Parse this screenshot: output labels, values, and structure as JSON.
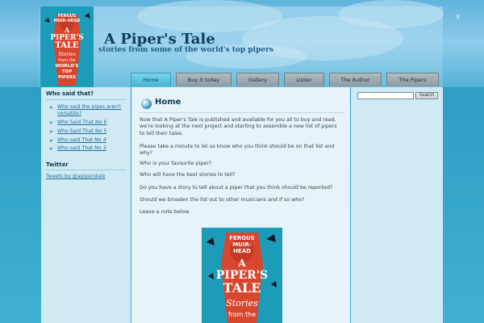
{
  "header": {
    "title": "A Piper's Tale",
    "subtitle": "stories from some of the world's top pipers",
    "close_label": "x"
  },
  "cover": {
    "author_line1": "FERGUS",
    "author_line2": "MUIR-",
    "author_line3": "HEAD",
    "title_line1": "A",
    "title_line2": "PIPER'S",
    "title_line3": "TALE",
    "tagline_line1": "Stories",
    "tagline_line2": "from the"
  },
  "cover_small": {
    "author_line1": "FERGUS",
    "author_line2": "MUIR-HEAD",
    "title_line1": "A",
    "title_line2": "PIPER'S",
    "title_line3": "TALE",
    "tagline_line1": "Stories",
    "tagline_line2": "from the",
    "tagline_line3": "WORLD'S",
    "tagline_line4": "TOP",
    "tagline_line5": "PIPERS"
  },
  "nav": {
    "tabs": [
      {
        "label": "Home",
        "active": true
      },
      {
        "label": "Buy it today"
      },
      {
        "label": "Gallery"
      },
      {
        "label": "Listen"
      },
      {
        "label": "The Author"
      },
      {
        "label": "The Pipers"
      }
    ]
  },
  "sidebar": {
    "heading": "Who said that?",
    "links": [
      "Who said the pipes aren't versatile?",
      "Who Said That No 6",
      "Who Said That No 5",
      "Who said That No 4",
      "Who said That No 3"
    ],
    "twitter_heading": "Twitter",
    "twitter_link": "Tweets by @apiperstale"
  },
  "main": {
    "title": "Home",
    "paragraphs": [
      "Now that A Piper's Tale is published and available for you all to buy and read, we're looking at the next project and starting to assemble a new list of pipers to tell their tales.",
      "Please take a minute to let us know who you think should be on that list and why?",
      "Who is your favourite piper?",
      "Who will have the best stories to tell?",
      "Do you have a story to tell about a piper that you think should be reported?",
      "Should we broaden the list out to other musicians and if so who?",
      "Leave a note below."
    ]
  },
  "search": {
    "placeholder": "",
    "button_label": "Search"
  },
  "colors": {
    "accent": "#43b5d6",
    "link": "#1f6d96",
    "title": "#0e3d5a",
    "cover_bg": "#1d9cb9",
    "cover_red": "#d9462e"
  },
  "icons": {
    "home": "globe-icon"
  }
}
